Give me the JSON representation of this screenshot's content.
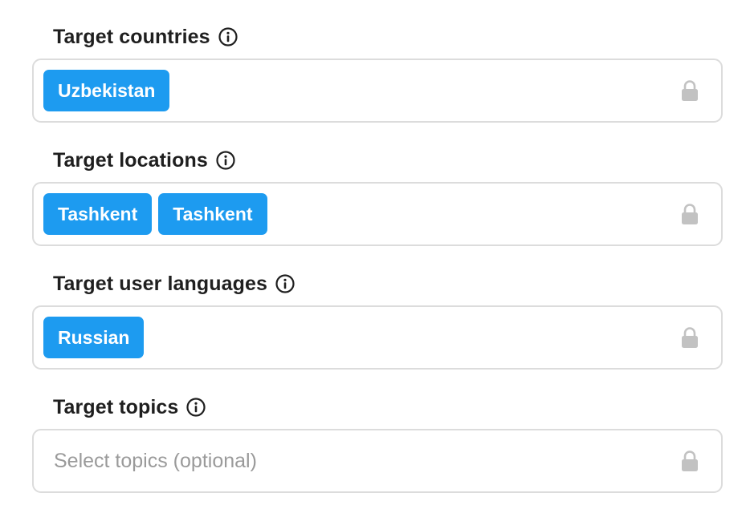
{
  "fields": [
    {
      "label": "Target countries",
      "chips": [
        "Uzbekistan"
      ],
      "placeholder": ""
    },
    {
      "label": "Target locations",
      "chips": [
        "Tashkent",
        "Tashkent"
      ],
      "placeholder": ""
    },
    {
      "label": "Target user languages",
      "chips": [
        "Russian"
      ],
      "placeholder": ""
    },
    {
      "label": "Target topics",
      "chips": [],
      "placeholder": "Select topics (optional)"
    }
  ],
  "icons": {
    "info": "info-icon",
    "lock": "lock-icon"
  },
  "colors": {
    "chip_bg": "#1d9bf0",
    "chip_text": "#ffffff",
    "field_border": "#dcdcdc",
    "lock": "#c2c2c2",
    "placeholder": "#9a9a9a",
    "label": "#1f1f1f"
  }
}
